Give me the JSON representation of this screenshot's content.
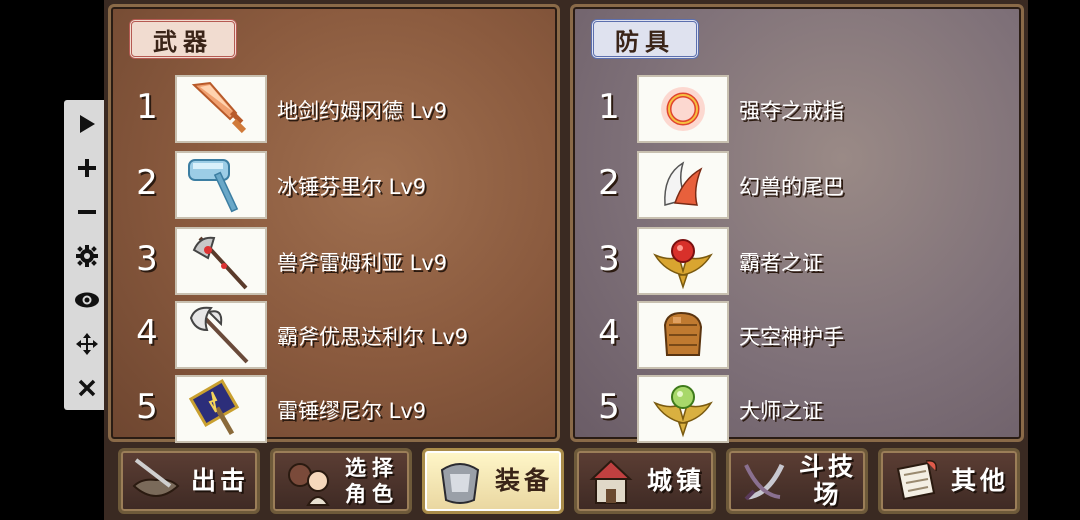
{
  "weapons": {
    "title": "武器",
    "items": [
      {
        "rank": "1",
        "name": "地剑约姆冈德 Lv9",
        "icon": "orange-sword-icon"
      },
      {
        "rank": "2",
        "name": "冰锤芬里尔 Lv9",
        "icon": "ice-hammer-icon"
      },
      {
        "rank": "3",
        "name": "兽斧雷姆利亚 Lv9",
        "icon": "beast-axe-icon"
      },
      {
        "rank": "4",
        "name": "霸斧优思达利尔 Lv9",
        "icon": "battle-axe-icon"
      },
      {
        "rank": "5",
        "name": "雷锤缪尼尔 Lv9",
        "icon": "thunder-hammer-icon"
      }
    ]
  },
  "armor": {
    "title": "防具",
    "items": [
      {
        "rank": "1",
        "name": "强夺之戒指",
        "icon": "ring-icon"
      },
      {
        "rank": "2",
        "name": "幻兽的尾巴",
        "icon": "tail-icon"
      },
      {
        "rank": "3",
        "name": "霸者之证",
        "icon": "red-emblem-icon"
      },
      {
        "rank": "4",
        "name": "天空神护手",
        "icon": "gauntlet-icon"
      },
      {
        "rank": "5",
        "name": "大师之证",
        "icon": "green-emblem-icon"
      }
    ]
  },
  "toolbar": [
    "play-icon",
    "plus-icon",
    "minus-icon",
    "gear-icon",
    "eye-icon",
    "move-icon",
    "close-icon"
  ],
  "nav": {
    "sortie": "出击",
    "select_line1": "选择",
    "select_line2": "角色",
    "equip": "装备",
    "town": "城镇",
    "arena": "斗技场",
    "other": "其他"
  },
  "colors": {
    "weapon_panel": "#8a5a3e",
    "armor_panel": "#7e7078",
    "active_button": "#fff7c9"
  }
}
